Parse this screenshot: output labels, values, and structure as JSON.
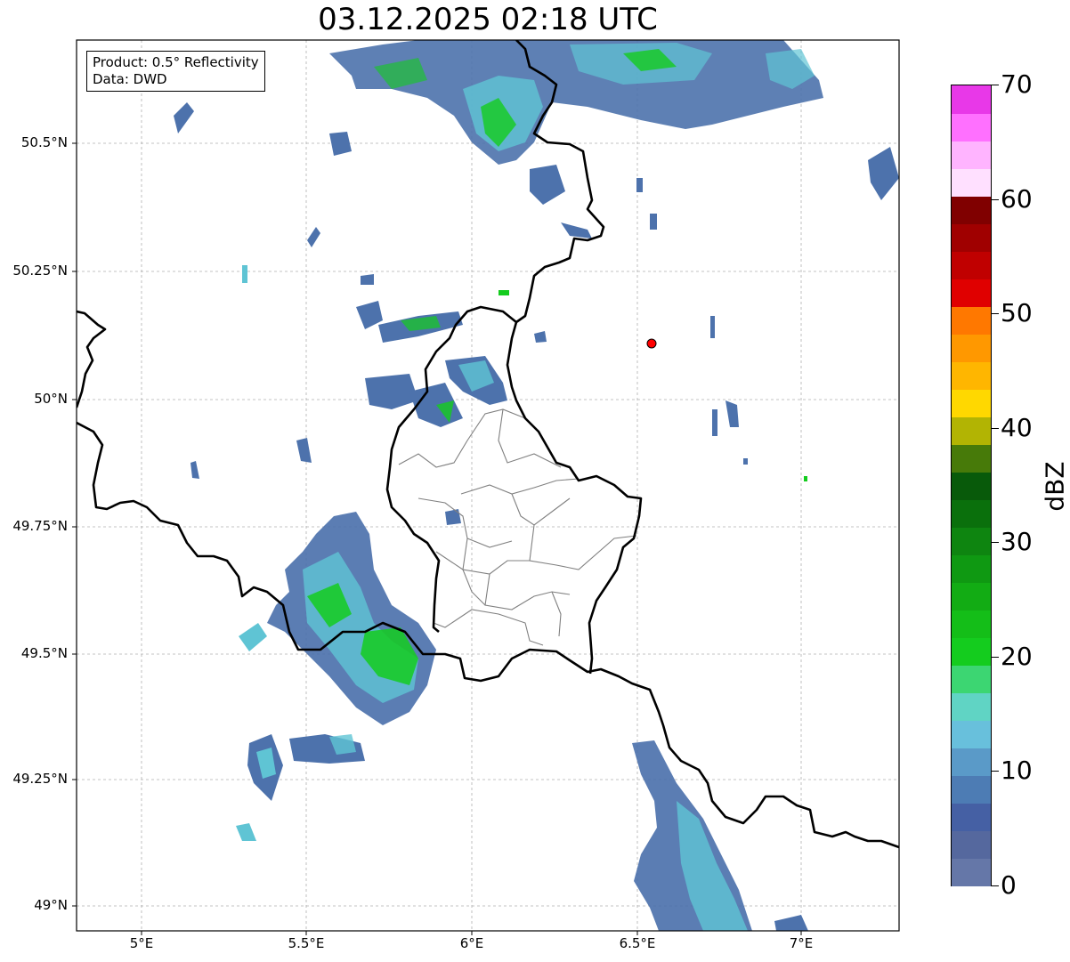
{
  "title": "03.12.2025 02:18 UTC",
  "info": {
    "product": "Product: 0.5° Reflectivity",
    "data": "Data: DWD"
  },
  "lat_labels": [
    "50.5°N",
    "50.25°N",
    "50°N",
    "49.75°N",
    "49.5°N",
    "49.25°N",
    "49°N"
  ],
  "lon_labels": [
    "5°E",
    "5.5°E",
    "6°E",
    "6.5°E",
    "7°E"
  ],
  "colorbar": {
    "label": "dBZ",
    "ticks": [
      "0",
      "10",
      "20",
      "30",
      "40",
      "50",
      "60",
      "70"
    ],
    "colors": [
      "#6577a8",
      "#55689e",
      "#4560a4",
      "#4d7cb4",
      "#5a9ac8",
      "#68c0dc",
      "#60d4c4",
      "#3cd672",
      "#14cc1e",
      "#14be18",
      "#12ac14",
      "#0f9912",
      "#0e8510",
      "#0a700c",
      "#085a0a",
      "#477a09",
      "#b2b403",
      "#ffd800",
      "#ffb600",
      "#ff9800",
      "#ff7800",
      "#e00000",
      "#c00000",
      "#a00000",
      "#800000",
      "#ffe0ff",
      "#ffb4ff",
      "#ff70ff",
      "#e838e8"
    ]
  },
  "station_marker": {
    "color": "#ff0000"
  },
  "map": {
    "extent_lon": [
      4.8,
      7.3
    ],
    "extent_lat": [
      48.95,
      50.7
    ],
    "country_border_color": "#000000",
    "admin_border_color": "#808080"
  }
}
